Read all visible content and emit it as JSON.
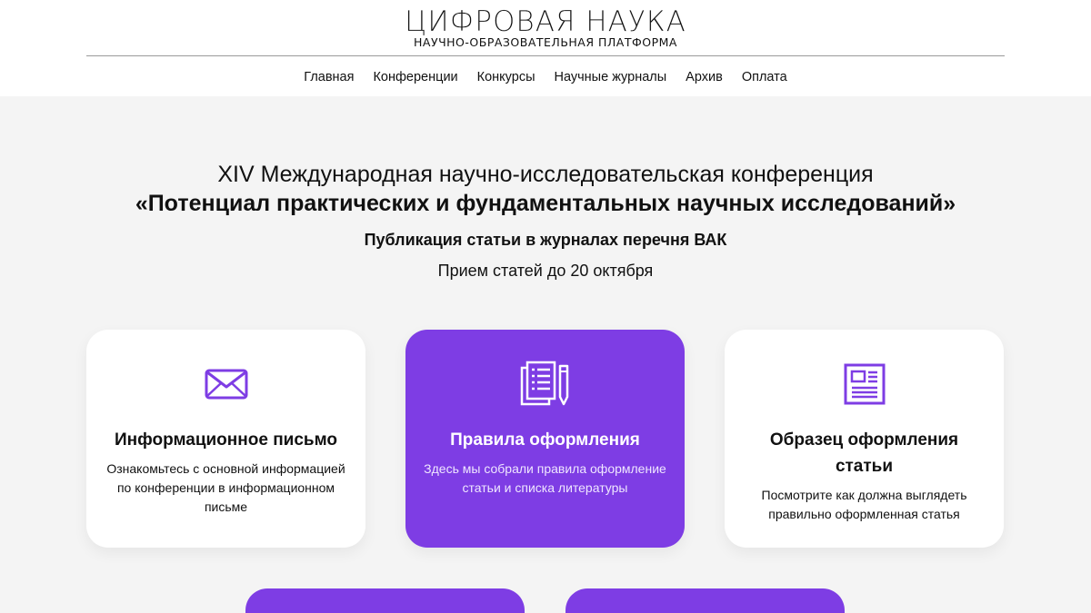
{
  "logo": {
    "title": "ЦИФРОВАЯ НАУКА",
    "subtitle": "НАУЧНО-ОБРАЗОВАТЕЛЬНАЯ ПЛАТФОРМА"
  },
  "nav": {
    "items": [
      "Главная",
      "Конференции",
      "Конкурсы",
      "Научные журналы",
      "Архив",
      "Оплата"
    ]
  },
  "hero": {
    "line1": "XIV Международная научно-исследовательская конференция",
    "line2": "«Потенциал практических и фундаментальных научных исследований»",
    "line3": "Публикация статьи в журналах перечня ВАК",
    "line4": "Прием статей до 20 октября"
  },
  "cards": [
    {
      "icon": "envelope-icon",
      "title": "Информационное письмо",
      "desc": "Ознакомьтесь с основной информацией по конференции в информационном письме"
    },
    {
      "icon": "document-pencil-icon",
      "title": "Правила оформления",
      "desc": "Здесь мы собрали правила оформление статьи и списка литературы"
    },
    {
      "icon": "article-layout-icon",
      "title": "Образец оформления статьи",
      "desc": "Посмотрите как должна выглядеть правильно оформленная статья"
    }
  ],
  "colors": {
    "accent": "#7e3de4",
    "background": "#f4f4f4",
    "card": "#ffffff"
  }
}
